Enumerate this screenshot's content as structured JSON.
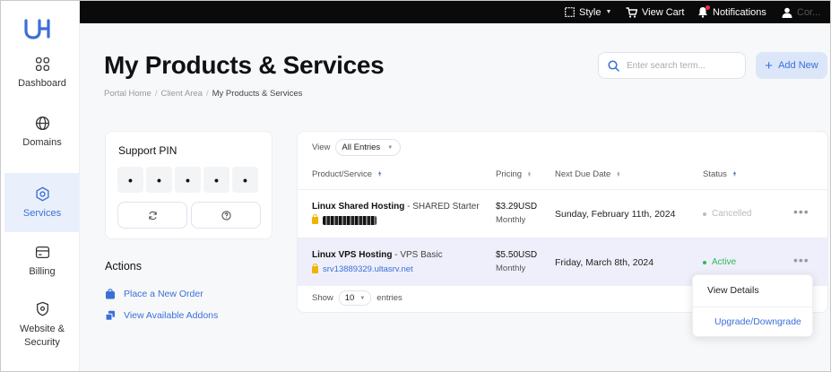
{
  "topbar": {
    "style_label": "Style",
    "cart_label": "View Cart",
    "notifications_label": "Notifications",
    "user_label": "Cor..."
  },
  "sidebar": {
    "items": [
      {
        "label": "Dashboard",
        "icon": "grid-icon"
      },
      {
        "label": "Domains",
        "icon": "globe-icon"
      },
      {
        "label": "Services",
        "icon": "hexagon-icon",
        "active": true
      },
      {
        "label": "Billing",
        "icon": "card-icon"
      },
      {
        "label": "Website & Security",
        "icon": "shield-icon"
      }
    ]
  },
  "header": {
    "title": "My Products & Services",
    "breadcrumb": [
      "Portal Home",
      "Client Area",
      "My Products & Services"
    ],
    "search_placeholder": "Enter search term...",
    "add_new_label": "Add New"
  },
  "support_pin": {
    "title": "Support PIN",
    "digits": [
      "•",
      "•",
      "•",
      "•",
      "•"
    ]
  },
  "actions": {
    "title": "Actions",
    "links": [
      "Place a New Order",
      "View Available Addons"
    ]
  },
  "table": {
    "view_label": "View",
    "view_value": "All Entries",
    "columns": [
      "Product/Service",
      "Pricing",
      "Next Due Date",
      "Status"
    ],
    "rows": [
      {
        "product": "Linux Shared Hosting",
        "plan": " - SHARED Starter",
        "domain": "",
        "price": "$3.29USD",
        "cycle": "Monthly",
        "due": "Sunday, February 11th, 2024",
        "status": "Cancelled",
        "status_color": "#bbbbbb"
      },
      {
        "product": "Linux VPS Hosting",
        "plan": " - VPS Basic",
        "domain": "srv13889329.ultasrv.net",
        "price": "$5.50USD",
        "cycle": "Monthly",
        "due": "Friday, March 8th, 2024",
        "status": "Active",
        "status_color": "#2fb85a"
      }
    ],
    "show_label": "Show",
    "show_value": "10",
    "entries_label": "entries"
  },
  "menu": {
    "items": [
      "View Details",
      "Upgrade/Downgrade"
    ]
  },
  "colors": {
    "accent": "#3b6fd8",
    "active_status": "#2fb85a",
    "cancelled_status": "#bbbbbb"
  }
}
